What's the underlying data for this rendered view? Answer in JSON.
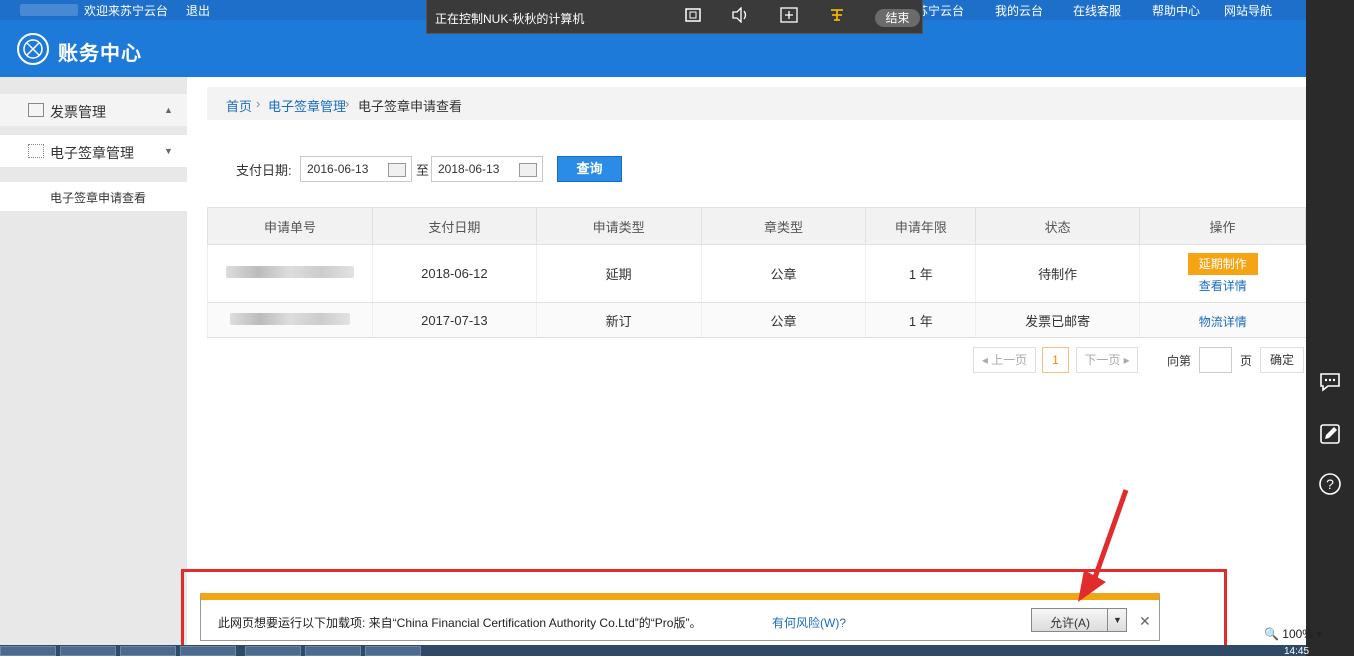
{
  "top_nav": {
    "welcome": "欢迎来苏宁云台",
    "logout": "退出",
    "links": [
      "苏宁云台",
      "我的云台",
      "在线客服",
      "帮助中心",
      "网站导航"
    ]
  },
  "remote_toolbar": {
    "label": "正在控制NUK-秋秋的计算机",
    "end": "结束"
  },
  "header": {
    "title": "账务中心"
  },
  "sidebar": {
    "items": [
      {
        "label": "发票管理"
      },
      {
        "label": "电子签章管理"
      }
    ],
    "sub_items": [
      {
        "label": "电子签章申请查看"
      }
    ]
  },
  "breadcrumb": {
    "home": "首页",
    "section": "电子签章管理",
    "current": "电子签章申请查看"
  },
  "filter": {
    "label": "支付日期:",
    "start_date": "2016-06-13",
    "to": "至",
    "end_date": "2018-06-13",
    "query": "查询"
  },
  "table": {
    "columns": [
      "申请单号",
      "支付日期",
      "申请类型",
      "章类型",
      "申请年限",
      "状态",
      "操作"
    ],
    "rows": [
      {
        "date": "2018-06-12",
        "type": "延期",
        "seal": "公章",
        "years": "1 年",
        "status": "待制作",
        "actions": [
          "延期制作",
          "查看详情"
        ]
      },
      {
        "date": "2017-07-13",
        "type": "新订",
        "seal": "公章",
        "years": "1 年",
        "status": "发票已邮寄",
        "actions": [
          "物流详情"
        ]
      }
    ]
  },
  "pagination": {
    "prev": "上一页",
    "page": "1",
    "next": "下一页",
    "goto_prefix": "向第",
    "goto_suffix": "页",
    "confirm": "确定"
  },
  "infobar": {
    "message": "此网页想要运行以下加载项: 来自“China Financial Certification Authority Co.Ltd”的“Pro版”。",
    "risk": "有何风险(W)?",
    "allow": "允许(A)"
  },
  "status": {
    "zoom": "100%",
    "clock": "14:45"
  },
  "colors": {
    "brand": "#1e7ad8",
    "accent_orange": "#f5a416",
    "highlight_red": "#e02c2c"
  }
}
